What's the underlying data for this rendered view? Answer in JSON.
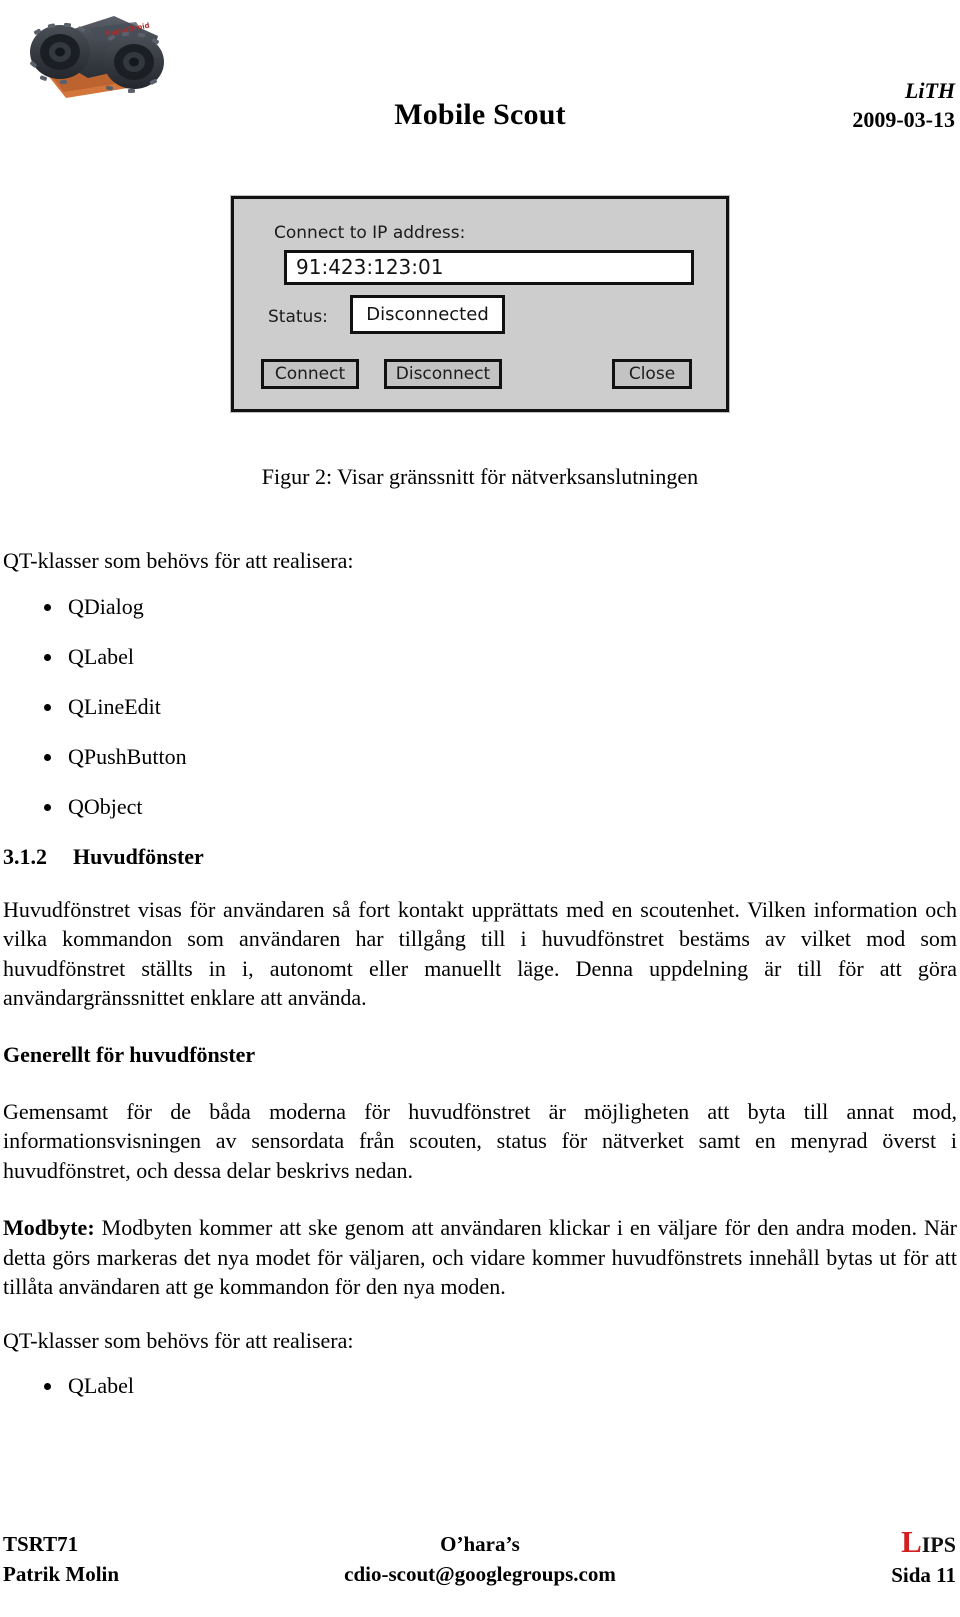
{
  "header": {
    "logo_alt": "mobile-scout-tracked-robot-photo",
    "title": "Mobile Scout",
    "university": "LiTH",
    "date": "2009-03-13"
  },
  "figure": {
    "dialog": {
      "ip_label": "Connect to IP address:",
      "ip_value": "91:423:123:01",
      "status_label": "Status:",
      "status_value": "Disconnected",
      "buttons": [
        {
          "label": "Connect"
        },
        {
          "label": "Disconnect"
        },
        {
          "label": "Close"
        }
      ],
      "colors": {
        "dialog_background": "#cdcdcd",
        "border": "#111111",
        "field_background": "#ffffff",
        "button_background": "#c3c3c3"
      }
    },
    "caption": "Figur 2: Visar gränssnitt för nätverksanslutningen"
  },
  "body": {
    "qt_intro_1": "QT-klasser som behövs för att realisera:",
    "qt_classes_1": [
      "QDialog",
      "QLabel",
      "QLineEdit",
      "QPushButton",
      "QObject"
    ],
    "section": {
      "number": "3.1.2",
      "title": "Huvudfönster"
    },
    "paragraph_1": "Huvudfönstret visas för användaren så fort kontakt upprättats med en scoutenhet. Vilken information och vilka kommandon som användaren har tillgång till i huvudfönstret bestäms av vilket mod som huvudfönstret ställts in i, autonomt eller manuellt läge. Denna uppdelning är till för att göra användargränssnittet enklare att använda.",
    "subsection_title": "Generellt för huvudfönster",
    "paragraph_2": "Gemensamt för de båda moderna för huvudfönstret är möjligheten att byta till annat mod, informationsvisningen av sensordata från scouten, status för nätverket samt en menyrad överst i huvudfönstret, och dessa delar beskrivs nedan.",
    "modbyte_term": "Modbyte:",
    "modbyte_text": " Modbyten kommer att ske genom att användaren klickar i en väljare för den andra moden. När detta görs markeras det nya modet för väljaren, och vidare kommer huvudfönstrets innehåll bytas ut för att tillåta användaren att ge kommandon för den nya moden.",
    "qt_intro_2": "QT-klasser som behövs för att realisera:",
    "qt_classes_2": [
      "QLabel"
    ]
  },
  "footer": {
    "course_code": "TSRT71",
    "author": "Patrik Molin",
    "group": "O’hara’s",
    "email": "cdio-scout@googlegroups.com",
    "logo_l": "L",
    "logo_rest": "IPS",
    "logo_accent_color": "#d21f1f",
    "page": "Sida 11"
  }
}
